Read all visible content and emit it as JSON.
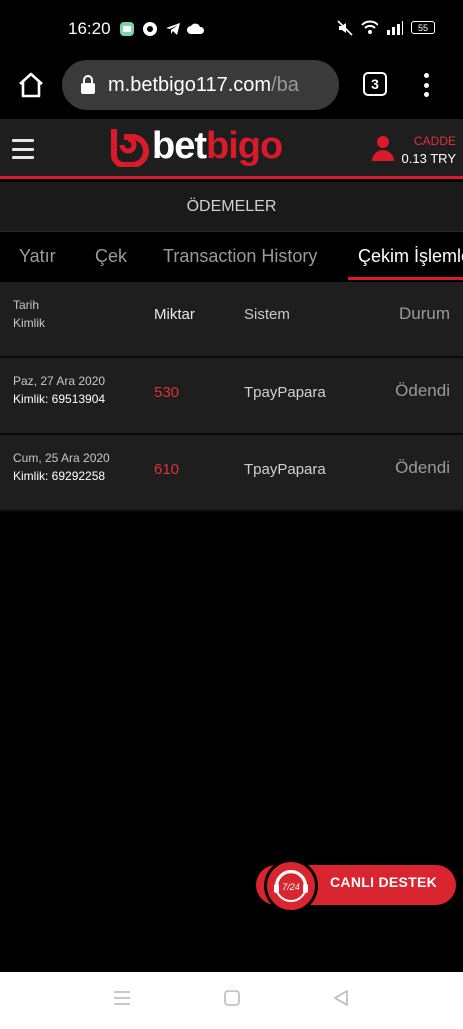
{
  "status_bar": {
    "time": "16:20",
    "battery": "55"
  },
  "browser": {
    "url_main": "m.betbigo117.com",
    "url_rest": "/ba",
    "tab_count": "3"
  },
  "header": {
    "logo_part1": "bet",
    "logo_part2": "bigo",
    "user_name": "CADDE",
    "balance": "0.13 TRY"
  },
  "page_title": "ÖDEMELER",
  "tabs": [
    {
      "label": "Yatır"
    },
    {
      "label": "Çek"
    },
    {
      "label": "Transaction History"
    },
    {
      "label": "Çekim İşlemleri",
      "active": true
    }
  ],
  "table": {
    "headers": {
      "date": "Tarih",
      "id": "Kimlik",
      "amount": "Miktar",
      "system": "Sistem",
      "status": "Durum"
    },
    "rows": [
      {
        "date": "Paz, 27 Ara 2020",
        "id": "Kimlik: 69513904",
        "amount": "530",
        "system": "TpayPapara",
        "status": "Ödendi"
      },
      {
        "date": "Cum, 25 Ara 2020",
        "id": "Kimlik: 69292258",
        "amount": "610",
        "system": "TpayPapara",
        "status": "Ödendi"
      }
    ]
  },
  "support": {
    "badge": "7/24",
    "label": "CANLI DESTEK"
  },
  "colors": {
    "accent": "#d91a2a",
    "background": "#000000",
    "panel": "#1e1e1e"
  }
}
